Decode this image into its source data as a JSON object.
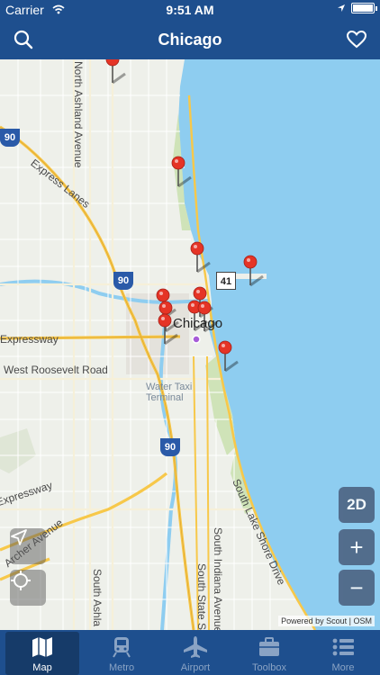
{
  "status_bar": {
    "carrier": "Carrier",
    "time": "9:51 AM",
    "battery_level": 1.0
  },
  "nav": {
    "title": "Chicago",
    "left_icon": "search-icon",
    "right_icon": "heart-icon"
  },
  "map": {
    "city_label": "Chicago",
    "street_labels": [
      "North Ashland Avenue",
      "Express Lanes",
      "West Roosevelt Road",
      "Water Taxi Terminal",
      "South Lake Shore Drive",
      "South Indiana Avenue",
      "South State St",
      "South Ashla",
      "Archer Avenue",
      "Expressway",
      "Expressway"
    ],
    "shields": [
      "90",
      "90",
      "90",
      "41"
    ],
    "attribution": "Powered by Scout | OSM",
    "pin_count": 11,
    "colors": {
      "water": "#8ecdf0",
      "land": "#eef0ea",
      "park": "#cfe3b8",
      "highway": "#f7c84a",
      "pin": "#e53426"
    }
  },
  "controls": {
    "mode_label": "2D",
    "zoom_in_label": "+",
    "zoom_out_label": "−",
    "locate_icon": "navigation-arrow-icon",
    "recenter_icon": "crosshair-icon"
  },
  "tabs": [
    {
      "label": "Map",
      "icon": "map-icon",
      "active": true
    },
    {
      "label": "Metro",
      "icon": "train-icon",
      "active": false
    },
    {
      "label": "Airport",
      "icon": "airplane-icon",
      "active": false
    },
    {
      "label": "Toolbox",
      "icon": "toolbox-icon",
      "active": false
    },
    {
      "label": "More",
      "icon": "list-icon",
      "active": false
    }
  ]
}
